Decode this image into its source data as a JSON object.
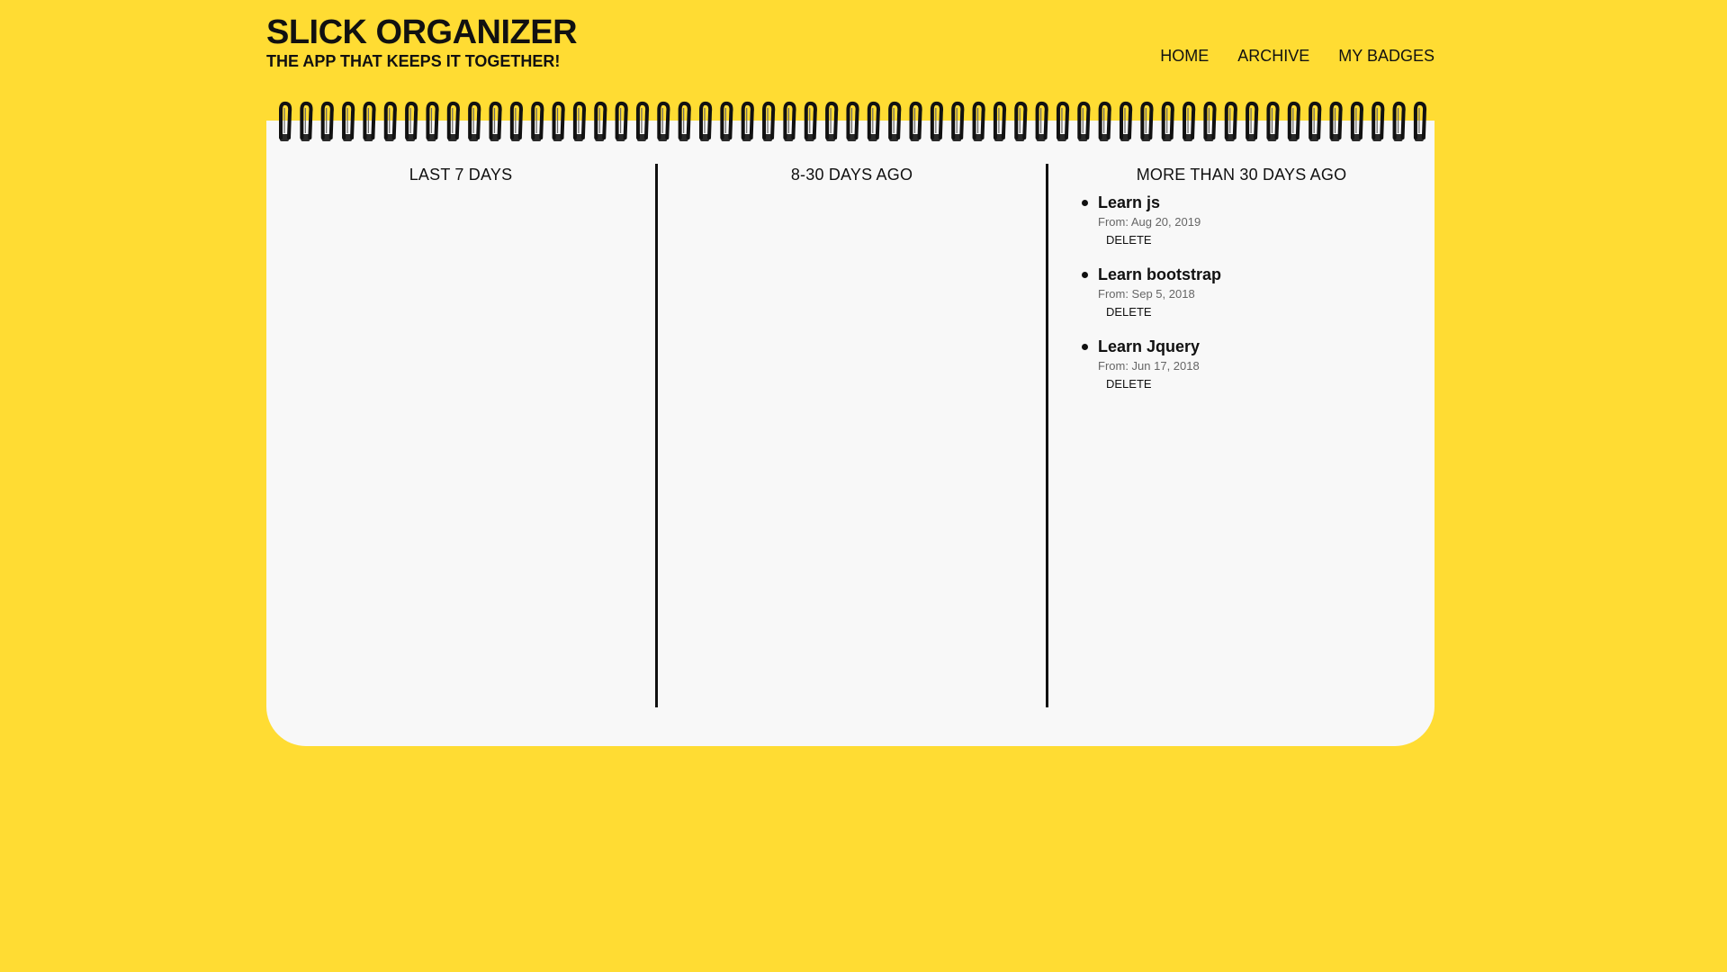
{
  "brand": {
    "title": "SLICK ORGANIZER",
    "tagline": "THE APP THAT KEEPS IT TOGETHER!"
  },
  "nav": {
    "home": "HOME",
    "archive": "ARCHIVE",
    "badges": "MY BADGES"
  },
  "columns": {
    "last7": {
      "heading": "LAST 7 DAYS"
    },
    "days8to30": {
      "heading": "8-30 DAYS AGO"
    },
    "over30": {
      "heading": "MORE THAN 30 DAYS AGO",
      "tasks": [
        {
          "title": "Learn js",
          "date": "From: Aug 20, 2019",
          "delete_label": "DELETE"
        },
        {
          "title": "Learn bootstrap",
          "date": "From: Sep 5, 2018",
          "delete_label": "DELETE"
        },
        {
          "title": "Learn Jquery",
          "date": "From: Jun 17, 2018",
          "delete_label": "DELETE"
        }
      ]
    }
  },
  "colors": {
    "background": "#FFDC33",
    "paper": "#F8F8F8",
    "ink": "#111111"
  },
  "icons": {
    "spiral": "spiral-binding-rings"
  }
}
